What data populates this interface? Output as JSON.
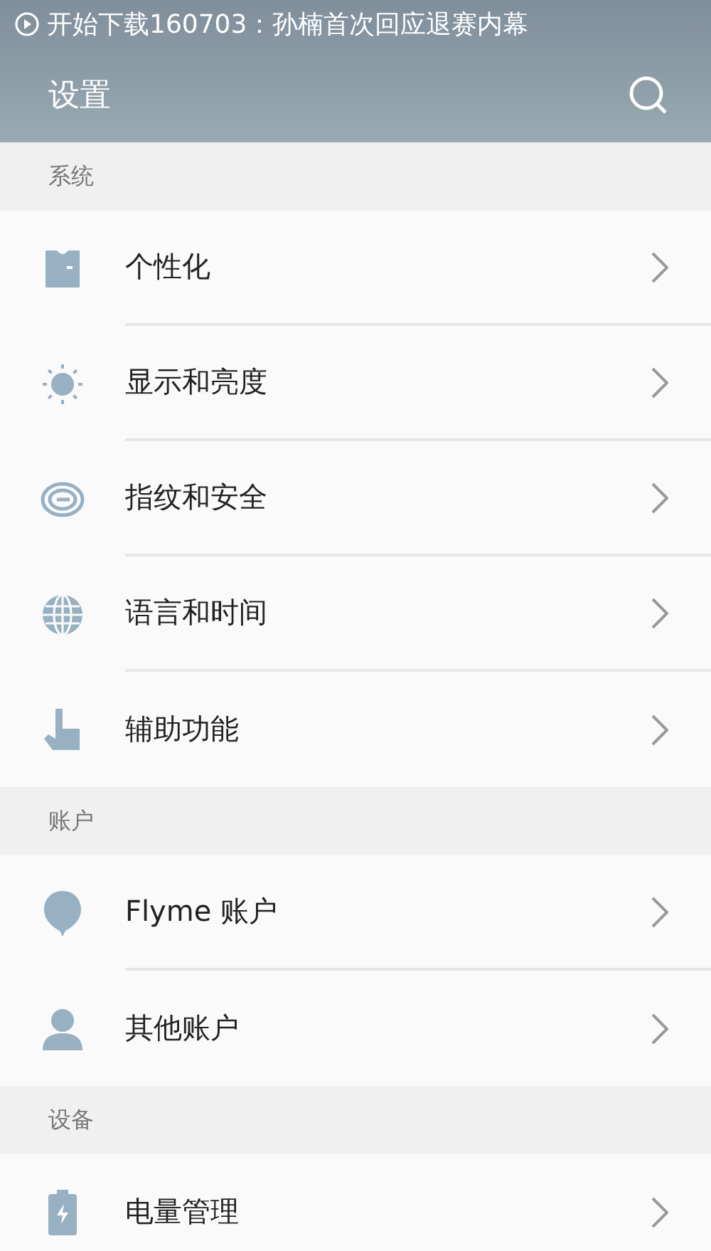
{
  "status_bar": {
    "notification": "开始下载160703：孙楠首次回应退赛内幕"
  },
  "header": {
    "title": "设置"
  },
  "sections": [
    {
      "title": "系统",
      "items": [
        {
          "label": "个性化"
        },
        {
          "label": "显示和亮度"
        },
        {
          "label": "指纹和安全"
        },
        {
          "label": "语言和时间"
        },
        {
          "label": "辅助功能"
        }
      ]
    },
    {
      "title": "账户",
      "items": [
        {
          "label": "Flyme 账户"
        },
        {
          "label": "其他账户"
        }
      ]
    },
    {
      "title": "设备",
      "items": [
        {
          "label": "电量管理"
        }
      ]
    }
  ]
}
